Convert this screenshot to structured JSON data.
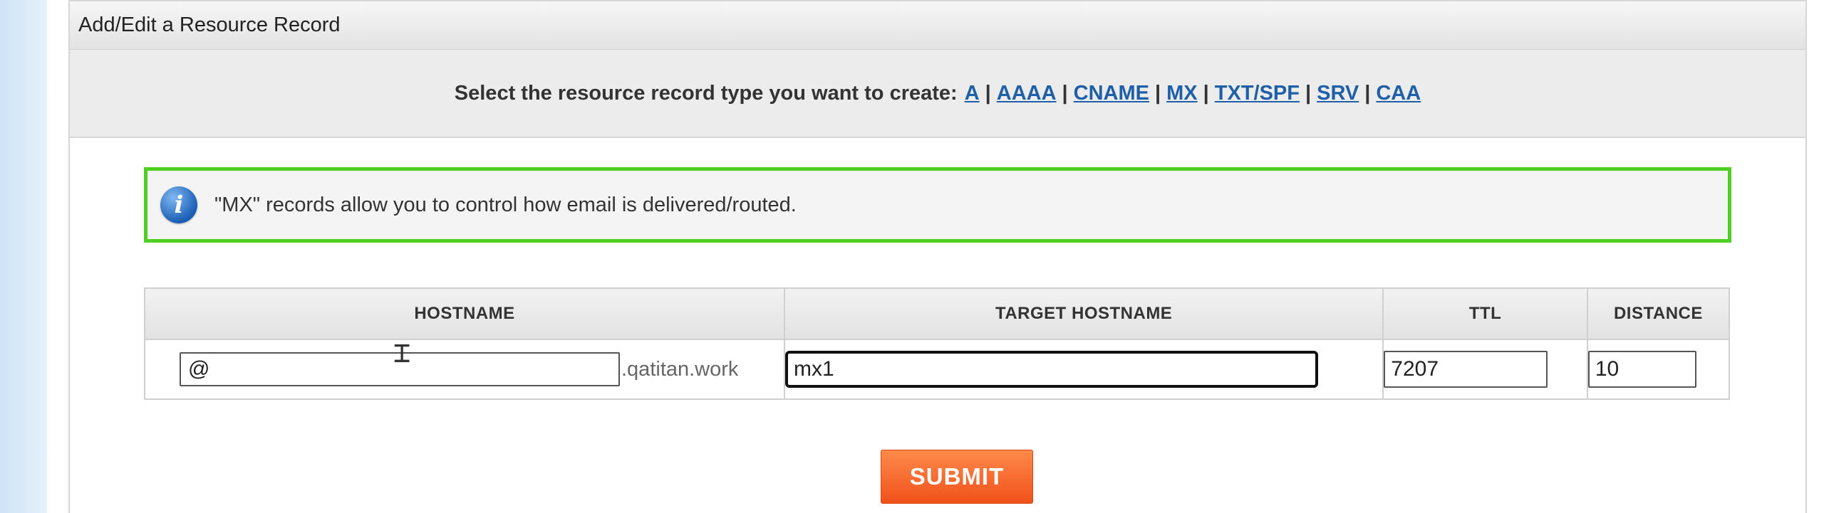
{
  "panel": {
    "title": "Add/Edit a Resource Record"
  },
  "type_selector": {
    "prompt": "Select the resource record type you want to create:",
    "types": [
      "A",
      "AAAA",
      "CNAME",
      "MX",
      "TXT/SPF",
      "SRV",
      "CAA"
    ],
    "separator": "|"
  },
  "info": {
    "icon": "info-icon",
    "message": "\"MX\" records allow you to control how email is delivered/routed."
  },
  "table": {
    "headers": {
      "hostname": "HOSTNAME",
      "target": "TARGET HOSTNAME",
      "ttl": "TTL",
      "distance": "DISTANCE"
    },
    "row": {
      "hostname_value": "@",
      "domain_suffix": ".qatitan.work",
      "target_value": "mx1",
      "ttl_value": "7207",
      "distance_value": "10"
    }
  },
  "submit_label": "SUBMIT",
  "colors": {
    "info_border": "#4fcf24",
    "link": "#1f5fa8",
    "submit": "#f0511a"
  }
}
